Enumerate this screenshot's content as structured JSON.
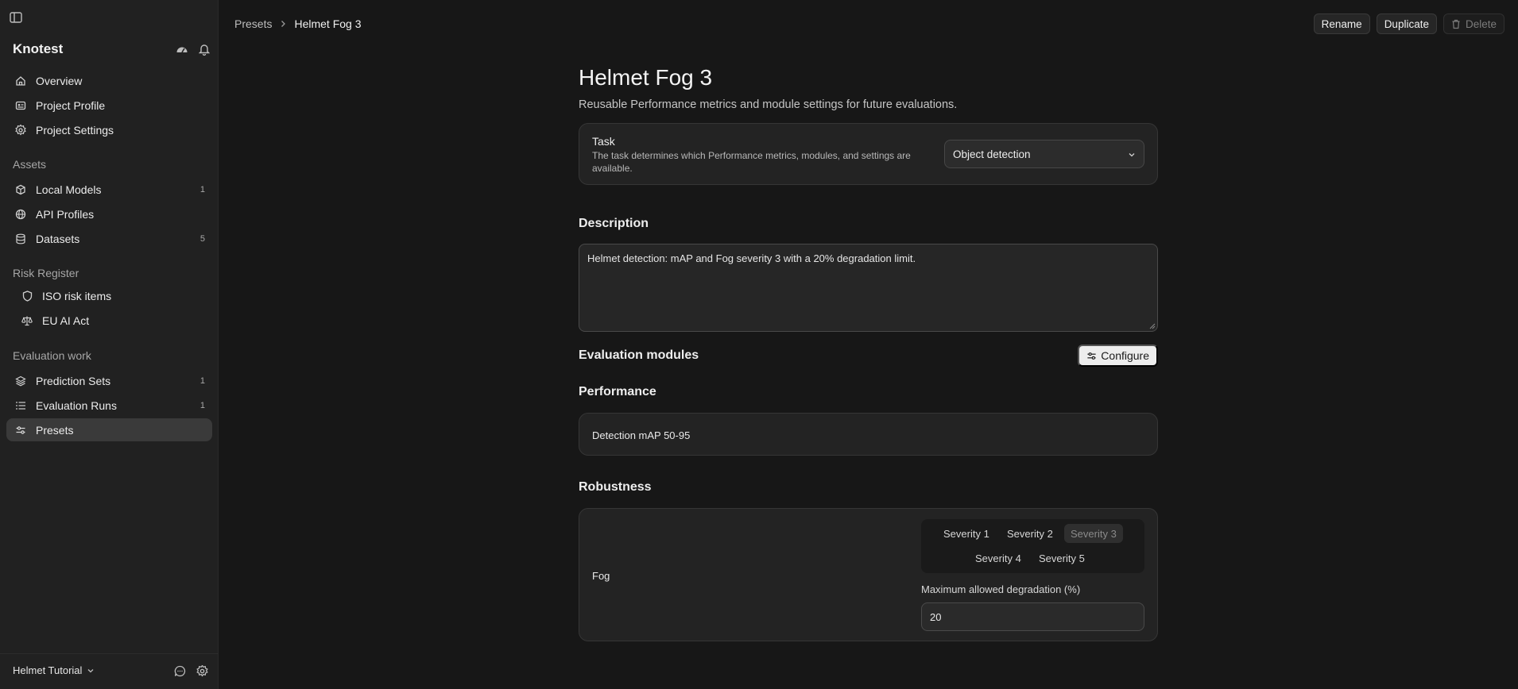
{
  "sidebar": {
    "brand": "Knotest",
    "nav": [
      {
        "label": "Overview",
        "icon": "home-icon"
      },
      {
        "label": "Project Profile",
        "icon": "id-card-icon"
      },
      {
        "label": "Project Settings",
        "icon": "gear-icon"
      }
    ],
    "sections": {
      "assets": "Assets",
      "risk": "Risk Register",
      "evaluation": "Evaluation work"
    },
    "assets": [
      {
        "label": "Local Models",
        "count": "1",
        "icon": "cube-icon"
      },
      {
        "label": "API Profiles",
        "count": "",
        "icon": "globe-icon"
      },
      {
        "label": "Datasets",
        "count": "5",
        "icon": "database-icon"
      }
    ],
    "risk": [
      {
        "label": "ISO risk items",
        "icon": "shield-icon"
      },
      {
        "label": "EU AI Act",
        "icon": "scale-icon"
      }
    ],
    "evaluation": [
      {
        "label": "Prediction Sets",
        "count": "1",
        "icon": "layers-icon"
      },
      {
        "label": "Evaluation Runs",
        "count": "1",
        "icon": "list-icon"
      },
      {
        "label": "Presets",
        "count": "",
        "icon": "sliders-icon",
        "active": true
      }
    ],
    "footer": {
      "workspace": "Helmet Tutorial"
    }
  },
  "breadcrumb": {
    "parent": "Presets",
    "current": "Helmet Fog 3"
  },
  "actions": {
    "rename": "Rename",
    "duplicate": "Duplicate",
    "delete": "Delete"
  },
  "page": {
    "title": "Helmet Fog 3",
    "subtitle": "Reusable Performance metrics and module settings for future evaluations."
  },
  "task": {
    "title": "Task",
    "description": "The task determines which Performance metrics, modules, and settings are available.",
    "selected": "Object detection"
  },
  "description": {
    "heading": "Description",
    "value": "Helmet detection: mAP and Fog severity 3 with a 20% degradation limit."
  },
  "modules": {
    "heading": "Evaluation modules",
    "configure": "Configure",
    "performance": {
      "heading": "Performance",
      "metric": "Detection mAP 50-95"
    },
    "robustness": {
      "heading": "Robustness",
      "module": "Fog",
      "severities": [
        "Severity 1",
        "Severity 2",
        "Severity 3",
        "Severity 4",
        "Severity 5"
      ],
      "selected_severity": "Severity 3",
      "degradation_label": "Maximum allowed degradation (%)",
      "degradation_value": "20"
    }
  }
}
